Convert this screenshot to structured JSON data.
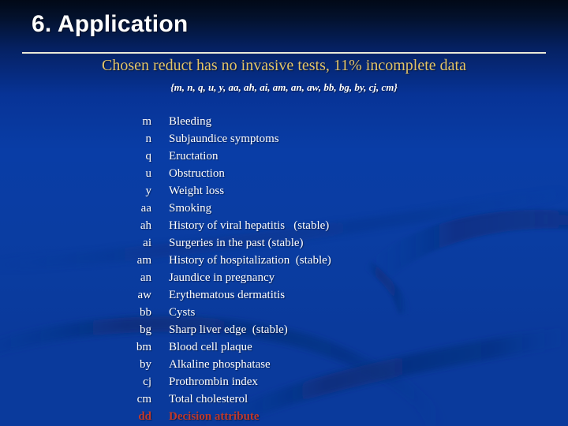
{
  "slide": {
    "title": "6. Application",
    "subtitle": "Chosen reduct  has no invasive tests, 11% incomplete data",
    "attribute_set": "{m, n, q, u, y, aa, ah, ai, am, an, aw, bb, bg, by, cj, cm}"
  },
  "colors": {
    "background_top": "#020917",
    "background_bottom": "#0a3a9c",
    "title_text": "#ffffff",
    "rule": "#e9e9d8",
    "subtitle_gold": "#e3c469",
    "body_text": "#ffffff",
    "decision_red": "#c0392b"
  },
  "legend": {
    "rows": [
      {
        "code": "m",
        "desc": "Bleeding"
      },
      {
        "code": "n",
        "desc": "Subjaundice symptoms"
      },
      {
        "code": "q",
        "desc": "Eructation"
      },
      {
        "code": "u",
        "desc": "Obstruction"
      },
      {
        "code": "y",
        "desc": "Weight loss"
      },
      {
        "code": "aa",
        "desc": "Smoking"
      },
      {
        "code": "ah",
        "desc": "History of viral hepatitis   (stable)"
      },
      {
        "code": "ai",
        "desc": "Surgeries in the past (stable)"
      },
      {
        "code": "am",
        "desc": "History of hospitalization  (stable)"
      },
      {
        "code": "an",
        "desc": "Jaundice in pregnancy"
      },
      {
        "code": "aw",
        "desc": "Erythematous dermatitis"
      },
      {
        "code": "bb",
        "desc": "Cysts"
      },
      {
        "code": "bg",
        "desc": "Sharp liver edge  (stable)"
      },
      {
        "code": "bm",
        "desc": "Blood cell plaque"
      },
      {
        "code": "by",
        "desc": "Alkaline phosphatase"
      },
      {
        "code": "cj",
        "desc": "Prothrombin index"
      },
      {
        "code": "cm",
        "desc": "Total cholesterol"
      },
      {
        "code": "dd",
        "desc": "Decision attribute",
        "decision": true
      }
    ]
  }
}
